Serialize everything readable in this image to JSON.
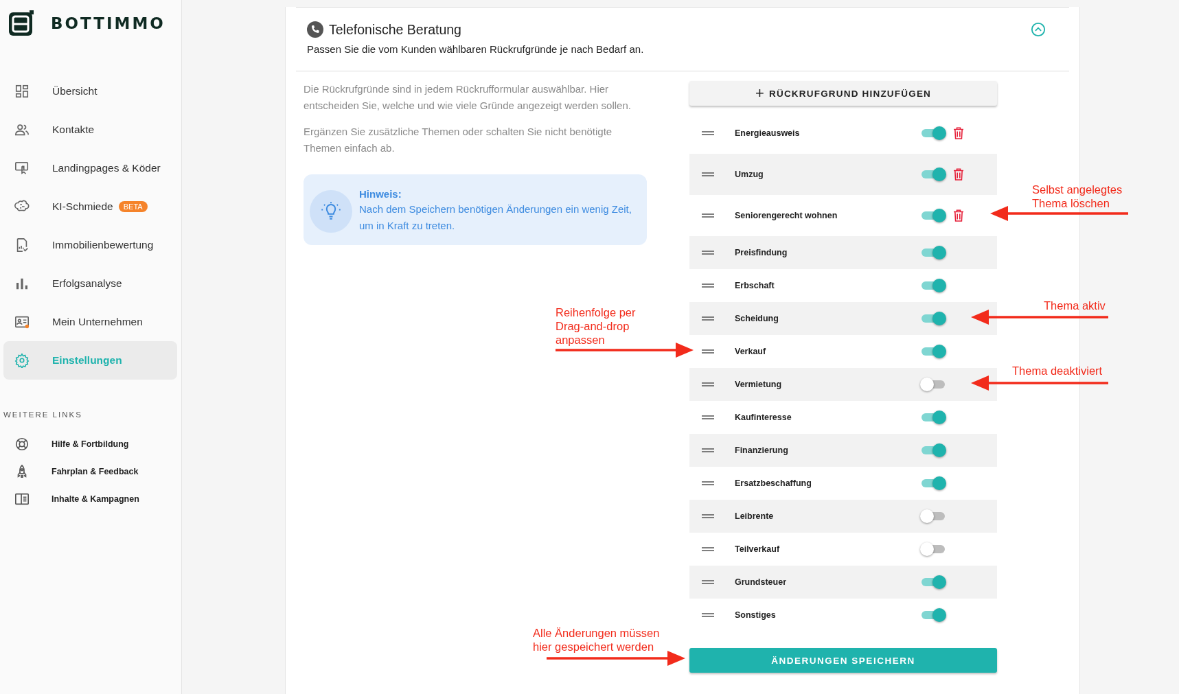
{
  "brand": {
    "name": "BOTTIMMO"
  },
  "sidebar": {
    "items": [
      {
        "label": "Übersicht",
        "selected": false
      },
      {
        "label": "Kontakte",
        "selected": false
      },
      {
        "label": "Landingpages & Köder",
        "selected": false
      },
      {
        "label": "KI-Schmiede",
        "selected": false,
        "badge": "BETA"
      },
      {
        "label": "Immobilienbewertung",
        "selected": false
      },
      {
        "label": "Erfolgsanalyse",
        "selected": false
      },
      {
        "label": "Mein Unternehmen",
        "selected": false
      },
      {
        "label": "Einstellungen",
        "selected": true
      }
    ],
    "section_title": "WEITERE LINKS",
    "links": [
      {
        "label": "Hilfe & Fortbildung"
      },
      {
        "label": "Fahrplan & Feedback"
      },
      {
        "label": "Inhalte & Kampagnen"
      }
    ]
  },
  "section": {
    "title": "Telefonische Beratung",
    "subtitle": "Passen Sie die vom Kunden wählbaren Rückrufgründe je nach Bedarf an.",
    "expanded": true,
    "paragraphs": [
      "Die Rückrufgründe sind in jedem Rückrufformular auswählbar. Hier entscheiden Sie, welche und wie viele Gründe angezeigt werden sollen.",
      "Ergänzen Sie zusätzliche Themen oder schalten Sie nicht benötigte Themen einfach ab."
    ],
    "hint": {
      "title": "Hinweis:",
      "text": "Nach dem Speichern benötigen Änderungen ein wenig Zeit, um in Kraft zu treten."
    },
    "add_button": {
      "icon": "+",
      "label": "RÜCKRUFGRUND HINZUFÜGEN"
    },
    "reasons": [
      {
        "label": "Energieausweis",
        "on": true,
        "deletable": true
      },
      {
        "label": "Umzug",
        "on": true,
        "deletable": true
      },
      {
        "label": "Seniorengerecht wohnen",
        "on": true,
        "deletable": true
      },
      {
        "label": "Preisfindung",
        "on": true,
        "deletable": false
      },
      {
        "label": "Erbschaft",
        "on": true,
        "deletable": false
      },
      {
        "label": "Scheidung",
        "on": true,
        "deletable": false
      },
      {
        "label": "Verkauf",
        "on": true,
        "deletable": false
      },
      {
        "label": "Vermietung",
        "on": false,
        "deletable": false
      },
      {
        "label": "Kaufinteresse",
        "on": true,
        "deletable": false
      },
      {
        "label": "Finanzierung",
        "on": true,
        "deletable": false
      },
      {
        "label": "Ersatzbeschaffung",
        "on": true,
        "deletable": false
      },
      {
        "label": "Leibrente",
        "on": false,
        "deletable": false
      },
      {
        "label": "Teilverkauf",
        "on": false,
        "deletable": false
      },
      {
        "label": "Grundsteuer",
        "on": true,
        "deletable": false
      },
      {
        "label": "Sonstiges",
        "on": true,
        "deletable": false
      }
    ],
    "save_button": "ÄNDERUNGEN SPEICHERN"
  },
  "annotations": [
    {
      "lines": [
        "Selbst angelegtes",
        "Thema löschen"
      ]
    },
    {
      "lines": [
        "Thema aktiv"
      ]
    },
    {
      "lines": [
        "Thema deaktiviert"
      ]
    },
    {
      "lines": [
        "Reihenfolge per",
        "Drag-and-drop",
        "anpassen"
      ]
    },
    {
      "lines": [
        "Alle Änderungen müssen",
        "hier gespeichert werden"
      ]
    }
  ]
}
